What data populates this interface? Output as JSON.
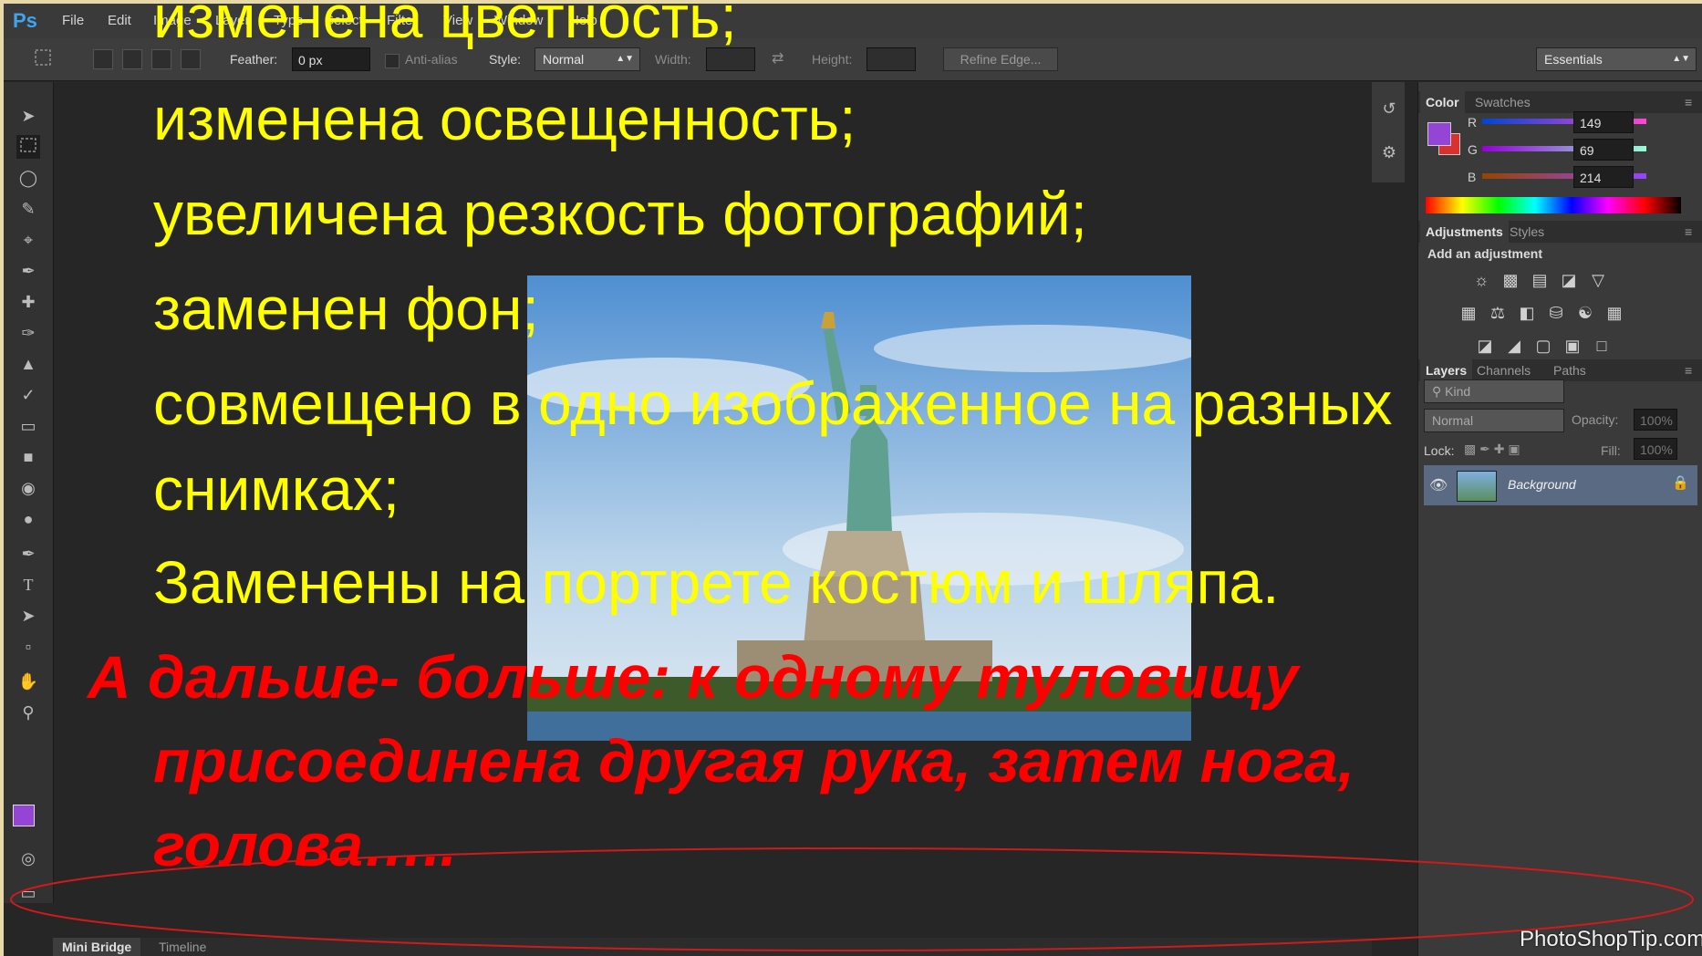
{
  "app": {
    "logo": "Ps",
    "menu": [
      "File",
      "Edit",
      "Image",
      "Layer",
      "Type",
      "Select",
      "Filter",
      "View",
      "Window",
      "Help"
    ]
  },
  "options_bar": {
    "feather_label": "Feather:",
    "feather_value": "0 px",
    "antialias_label": "Anti-alias",
    "style_label": "Style:",
    "style_value": "Normal",
    "width_label": "Width:",
    "height_label": "Height:",
    "refine_edge": "Refine Edge...",
    "workspace": "Essentials"
  },
  "color_panel": {
    "tabs": [
      "Color",
      "Swatches"
    ],
    "r_label": "R",
    "r_value": "149",
    "g_label": "G",
    "g_value": "69",
    "b_label": "B",
    "b_value": "214",
    "fg_color": "#9545d6",
    "bg_color": "#d8312e"
  },
  "adjustments_panel": {
    "tabs": [
      "Adjustments",
      "Styles"
    ],
    "heading": "Add an adjustment"
  },
  "layers_panel": {
    "tabs": [
      "Layers",
      "Channels",
      "Paths"
    ],
    "kind": "Kind",
    "blend_mode": "Normal",
    "opacity_label": "Opacity:",
    "opacity_value": "100%",
    "lock_label": "Lock:",
    "fill_label": "Fill:",
    "fill_value": "100%",
    "layer_name": "Background"
  },
  "bottom_tabs": [
    "Mini Bridge",
    "Timeline"
  ],
  "slide": {
    "bullet_glyph": "",
    "lines": [
      "изменена цветность;",
      "изменена освещенность;",
      "увеличена резкость фотографий;",
      "заменен фон;",
      "совмещено в одно изображенное на разных",
      "снимках;",
      "Заменены на портрете костюм и шляпа."
    ],
    "red_lines": [
      "А дальше- больше: к одному туловищу",
      "присоединена другая рука, затем нога,",
      "голова….."
    ]
  },
  "watermark": "PhotoShopTip.com"
}
